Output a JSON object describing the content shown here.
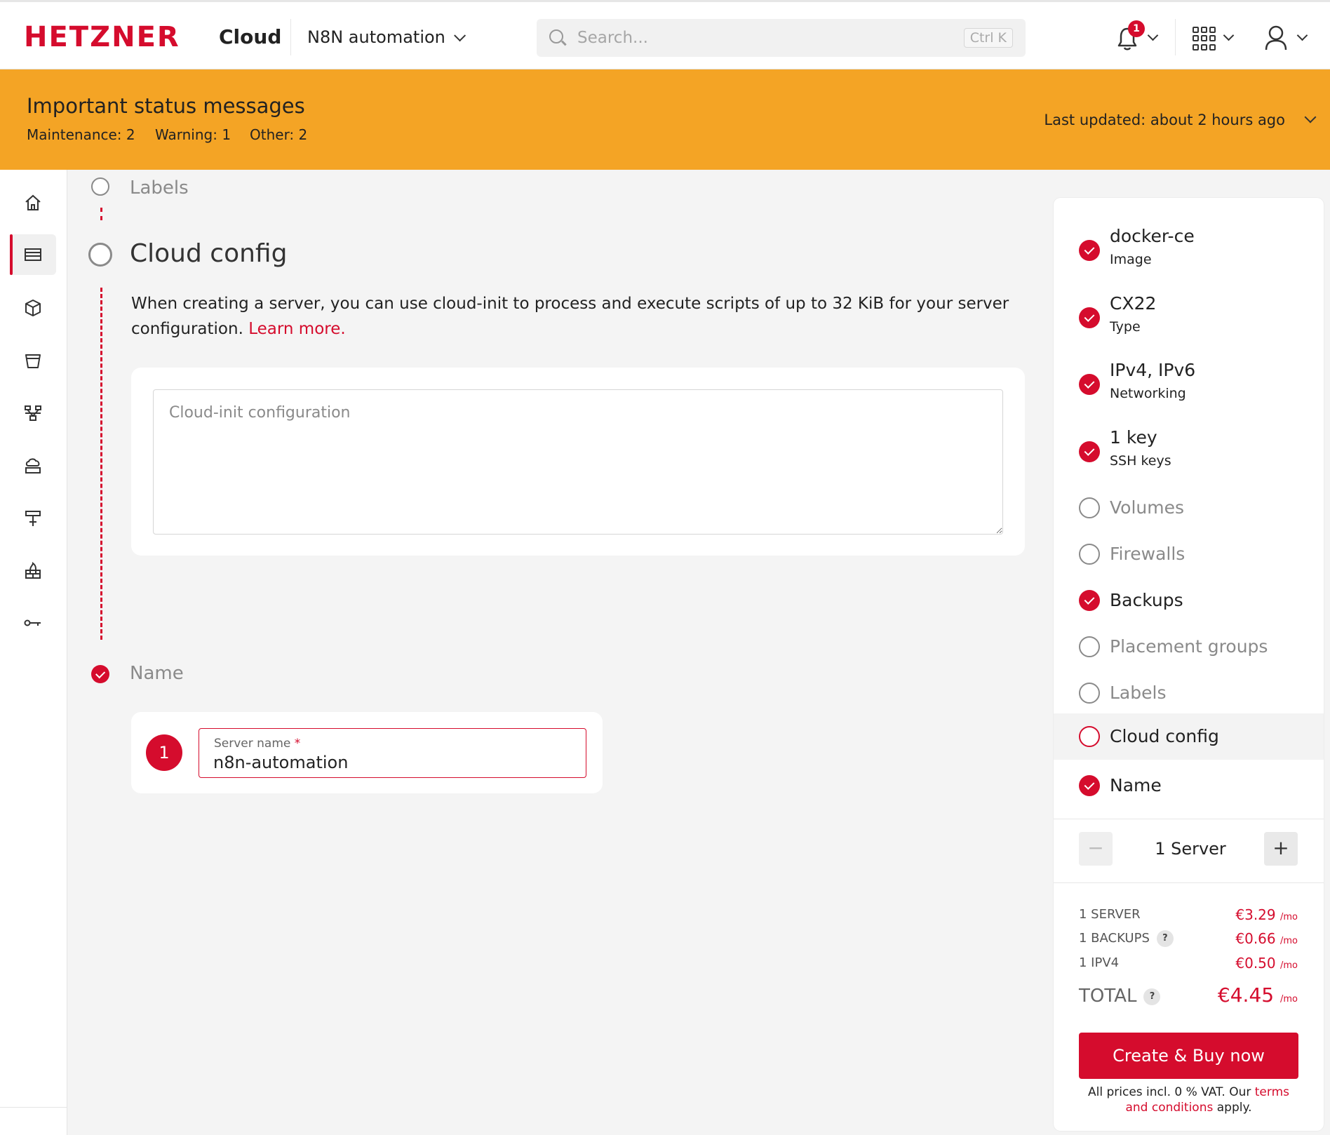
{
  "header": {
    "logo": "HETZNER",
    "product": "Cloud",
    "project": "N8N automation",
    "search_placeholder": "Search...",
    "search_shortcut": "Ctrl K",
    "notification_count": "1"
  },
  "banner": {
    "title": "Important status messages",
    "maintenance_label": "Maintenance:",
    "maintenance_count": "2",
    "warning_label": "Warning:",
    "warning_count": "1",
    "other_label": "Other:",
    "other_count": "2",
    "updated_label": "Last updated:",
    "updated_value": "about 2 hours ago"
  },
  "nav": {
    "items": [
      "home-icon",
      "servers-icon",
      "box-icon",
      "bucket-icon",
      "network-icon",
      "cloud-drive-icon",
      "load-balancer-icon",
      "firewall-icon",
      "key-icon"
    ],
    "active": "servers-icon"
  },
  "steps": {
    "labels_title": "Labels",
    "cloud_config_title": "Cloud config",
    "cloud_config_desc": "When creating a server, you can use cloud-init to process and execute scripts of up to 32 KiB for your server configuration.",
    "learn_more": "Learn more.",
    "cloud_init_placeholder": "Cloud-init configuration",
    "name_title": "Name",
    "server_number": "1",
    "server_name_label": "Server name",
    "server_name_required": "*",
    "server_name_value": "n8n-automation"
  },
  "summary": {
    "items": [
      {
        "main": "docker-ce",
        "sub": "Image",
        "done": true
      },
      {
        "main": "CX22",
        "sub": "Type",
        "done": true
      },
      {
        "main": "IPv4, IPv6",
        "sub": "Networking",
        "done": true
      },
      {
        "main": "1 key",
        "sub": "SSH keys",
        "done": true
      },
      {
        "main": "Volumes",
        "done": false
      },
      {
        "main": "Firewalls",
        "done": false
      },
      {
        "main": "Backups",
        "done": true
      },
      {
        "main": "Placement groups",
        "done": false
      },
      {
        "main": "Labels",
        "done": false
      },
      {
        "main": "Cloud config",
        "done": false,
        "current": true
      },
      {
        "main": "Name",
        "done": true
      }
    ],
    "quantity": "1 Server",
    "minus": "−",
    "plus": "+",
    "prices": [
      {
        "label": "1 SERVER",
        "value": "€3.29",
        "unit": "/mo"
      },
      {
        "label": "1 BACKUPS",
        "value": "€0.66",
        "unit": "/mo",
        "help": "?"
      },
      {
        "label": "1 IPV4",
        "value": "€0.50",
        "unit": "/mo"
      }
    ],
    "total_label": "TOTAL",
    "total_help": "?",
    "total_value": "€4.45",
    "total_unit": "/mo",
    "buy_label": "Create & Buy now",
    "fine_pre": "All prices incl. 0 % VAT. Our",
    "fine_link": "terms and conditions",
    "fine_post": "apply."
  },
  "colors": {
    "brand": "#d50c2d",
    "banner": "#f4a425"
  }
}
